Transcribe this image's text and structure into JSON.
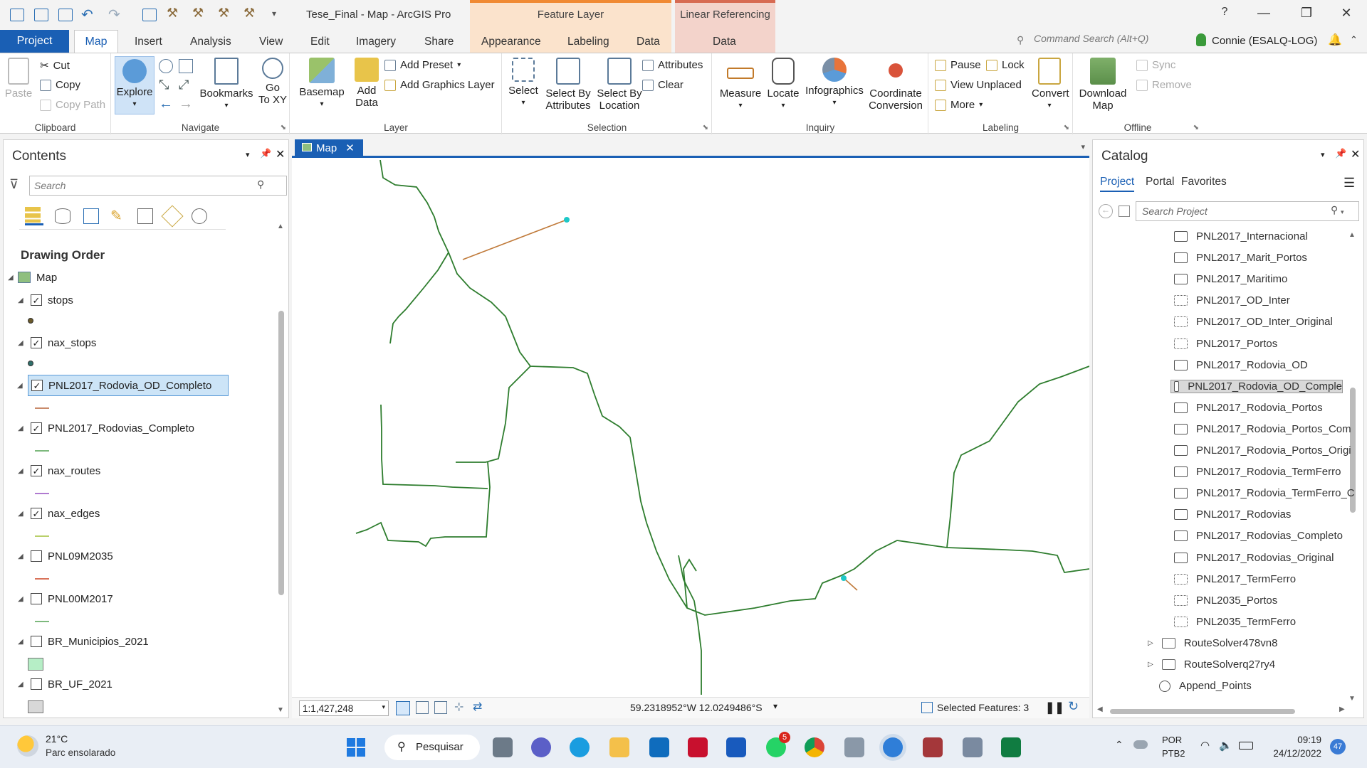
{
  "window": {
    "title": "Tese_Final - Map - ArcGIS Pro",
    "help": "?"
  },
  "context_tabs": {
    "feature_layer": {
      "label": "Feature Layer",
      "tabs": [
        "Appearance",
        "Labeling",
        "Data"
      ]
    },
    "linear_referencing": {
      "label": "Linear Referencing",
      "tabs": [
        "Data"
      ]
    }
  },
  "tabs": [
    "Project",
    "Map",
    "Insert",
    "Analysis",
    "View",
    "Edit",
    "Imagery",
    "Share"
  ],
  "command_search": {
    "placeholder": "Command Search (Alt+Q)"
  },
  "user": "Connie (ESALQ-LOG)",
  "ribbon": {
    "clipboard": {
      "label": "Clipboard",
      "paste": "Paste",
      "cut": "Cut",
      "copy": "Copy",
      "copy_path": "Copy Path"
    },
    "navigate": {
      "label": "Navigate",
      "explore": "Explore",
      "bookmarks": "Bookmarks",
      "goto": "Go\nTo XY"
    },
    "layer": {
      "label": "Layer",
      "basemap": "Basemap",
      "add_data": "Add\nData",
      "add_preset": "Add Preset",
      "add_graphics": "Add Graphics Layer"
    },
    "selection": {
      "label": "Selection",
      "select": "Select",
      "select_by_attr": "Select By\nAttributes",
      "select_by_loc": "Select By\nLocation",
      "attributes": "Attributes",
      "clear": "Clear"
    },
    "inquiry": {
      "label": "Inquiry",
      "measure": "Measure",
      "locate": "Locate",
      "infographics": "Infographics",
      "coordinate": "Coordinate\nConversion"
    },
    "labeling": {
      "label": "Labeling",
      "pause": "Pause",
      "lock": "Lock",
      "view_unplaced": "View Unplaced",
      "more": "More",
      "convert": "Convert"
    },
    "offline": {
      "label": "Offline",
      "download": "Download\nMap",
      "sync": "Sync",
      "remove": "Remove"
    }
  },
  "contents": {
    "title": "Contents",
    "search_placeholder": "Search",
    "section": "Drawing Order",
    "map_name": "Map",
    "layers": [
      {
        "name": "stops",
        "checked": true,
        "symbol_color": "#6b5a2a",
        "symbol": "point"
      },
      {
        "name": "nax_stops",
        "checked": true,
        "symbol_color": "#2f6f6a",
        "symbol": "point"
      },
      {
        "name": "PNL2017_Rodovia_OD_Completo",
        "checked": true,
        "selected": true,
        "symbol_color": "#c98a6a",
        "symbol": "line"
      },
      {
        "name": "PNL2017_Rodovias_Completo",
        "checked": true,
        "symbol_color": "#7db97d",
        "symbol": "line"
      },
      {
        "name": "nax_routes",
        "checked": true,
        "symbol_color": "#b07ad0",
        "symbol": "line"
      },
      {
        "name": "nax_edges",
        "checked": true,
        "symbol_color": "#b9d06a",
        "symbol": "line"
      },
      {
        "name": "PNL09M2035",
        "checked": false,
        "symbol_color": "#d9735a",
        "symbol": "line"
      },
      {
        "name": "PNL00M2017",
        "checked": false,
        "symbol_color": "#7db97d",
        "symbol": "line"
      },
      {
        "name": "BR_Municipios_2021",
        "checked": false,
        "symbol_color": "#b6eec6",
        "symbol": "fill"
      },
      {
        "name": "BR_UF_2021",
        "checked": false,
        "symbol_color": "#d8d8d8",
        "symbol": "fill"
      }
    ]
  },
  "map": {
    "tab_label": "Map",
    "scale": "1:1,427,248",
    "coordinates": "59.2318952°W 12.0249486°S",
    "selected_features": "Selected Features: 3"
  },
  "catalog": {
    "title": "Catalog",
    "tabs": [
      "Project",
      "Portal",
      "Favorites"
    ],
    "search_placeholder": "Search Project",
    "items": [
      {
        "name": "PNL2017_Internacional",
        "type": "line"
      },
      {
        "name": "PNL2017_Marit_Portos",
        "type": "line"
      },
      {
        "name": "PNL2017_Maritimo",
        "type": "line"
      },
      {
        "name": "PNL2017_OD_Inter",
        "type": "point"
      },
      {
        "name": "PNL2017_OD_Inter_Original",
        "type": "point"
      },
      {
        "name": "PNL2017_Portos",
        "type": "point"
      },
      {
        "name": "PNL2017_Rodovia_OD",
        "type": "line"
      },
      {
        "name": "PNL2017_Rodovia_OD_Comple",
        "type": "line",
        "selected": true
      },
      {
        "name": "PNL2017_Rodovia_Portos",
        "type": "line"
      },
      {
        "name": "PNL2017_Rodovia_Portos_Com",
        "type": "line"
      },
      {
        "name": "PNL2017_Rodovia_Portos_Origi",
        "type": "line"
      },
      {
        "name": "PNL2017_Rodovia_TermFerro",
        "type": "line"
      },
      {
        "name": "PNL2017_Rodovia_TermFerro_C",
        "type": "line"
      },
      {
        "name": "PNL2017_Rodovias",
        "type": "line"
      },
      {
        "name": "PNL2017_Rodovias_Completo",
        "type": "line"
      },
      {
        "name": "PNL2017_Rodovias_Original",
        "type": "line"
      },
      {
        "name": "PNL2017_TermFerro",
        "type": "point"
      },
      {
        "name": "PNL2035_Portos",
        "type": "point"
      },
      {
        "name": "PNL2035_TermFerro",
        "type": "point"
      }
    ],
    "folders": [
      "RouteSolver478vn8",
      "RouteSolverq27ry4"
    ],
    "tools": [
      "Append_Points"
    ]
  },
  "taskbar": {
    "weather_temp": "21°C",
    "weather_desc": "Parc ensolarado",
    "search": "Pesquisar",
    "whatsapp_badge": "5",
    "lang1": "POR",
    "lang2": "PTB2",
    "time": "09:19",
    "date": "24/12/2022",
    "notif_count": "47"
  }
}
